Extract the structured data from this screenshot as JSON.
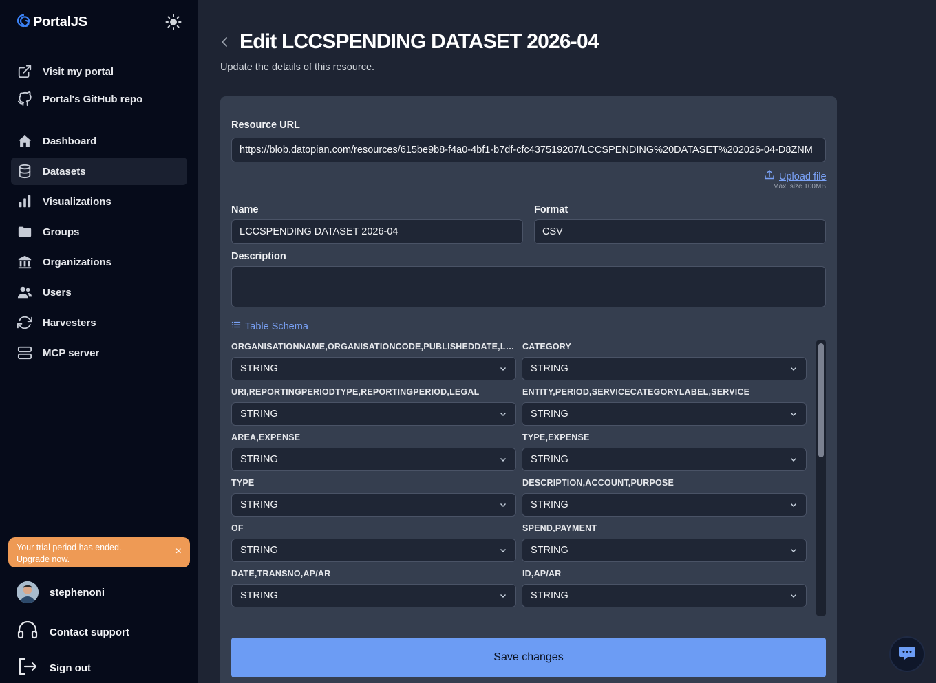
{
  "sidebar": {
    "brand": "PortalJS",
    "top_links": [
      {
        "label": "Visit my portal",
        "icon": "external-link-icon"
      },
      {
        "label": "Portal's GitHub repo",
        "icon": "github-icon"
      }
    ],
    "nav": [
      {
        "label": "Dashboard",
        "icon": "home-icon",
        "active": false
      },
      {
        "label": "Datasets",
        "icon": "database-icon",
        "active": true
      },
      {
        "label": "Visualizations",
        "icon": "bar-chart-icon",
        "active": false
      },
      {
        "label": "Groups",
        "icon": "folder-icon",
        "active": false
      },
      {
        "label": "Organizations",
        "icon": "building-icon",
        "active": false
      },
      {
        "label": "Users",
        "icon": "users-icon",
        "active": false
      },
      {
        "label": "Harvesters",
        "icon": "refresh-icon",
        "active": false
      },
      {
        "label": "MCP server",
        "icon": "server-icon",
        "active": false
      }
    ],
    "trial": {
      "text": "Your trial period has ended.",
      "link": "Upgrade now.",
      "close": "×"
    },
    "user": {
      "name": "stephenoni"
    },
    "contact": "Contact support",
    "signout": "Sign out"
  },
  "page": {
    "title": "Edit LCCSPENDING DATASET 2026-04",
    "subtitle": "Update the details of this resource."
  },
  "form": {
    "resource_url_label": "Resource URL",
    "resource_url_value": "https://blob.datopian.com/resources/615be9b8-f4a0-4bf1-b7df-cfc437519207/LCCSPENDING%20DATASET%202026-04-D8ZNM",
    "upload_label": "Upload file",
    "max_size": "Max. size 100MB",
    "name_label": "Name",
    "name_value": "LCCSPENDING DATASET 2026-04",
    "format_label": "Format",
    "format_value": "CSV",
    "description_label": "Description",
    "description_value": "",
    "schema_toggle": "Table Schema",
    "schema_fields": [
      {
        "name": "ORGANISATIONNAME,ORGANISATIONCODE,PUBLISHEDDATE,LA...",
        "type": "STRING"
      },
      {
        "name": "CATEGORY",
        "type": "STRING"
      },
      {
        "name": "URI,REPORTINGPERIODTYPE,REPORTINGPERIOD,LEGAL",
        "type": "STRING"
      },
      {
        "name": "ENTITY,PERIOD,SERVICECATEGORYLABEL,SERVICE",
        "type": "STRING"
      },
      {
        "name": "AREA,EXPENSE",
        "type": "STRING"
      },
      {
        "name": "TYPE,EXPENSE",
        "type": "STRING"
      },
      {
        "name": "TYPE",
        "type": "STRING"
      },
      {
        "name": "DESCRIPTION,ACCOUNT,PURPOSE",
        "type": "STRING"
      },
      {
        "name": "OF",
        "type": "STRING"
      },
      {
        "name": "SPEND,PAYMENT",
        "type": "STRING"
      },
      {
        "name": "DATE,TRANSNO,AP/AR",
        "type": "STRING"
      },
      {
        "name": "ID,AP/AR",
        "type": "STRING"
      }
    ],
    "save_label": "Save changes"
  },
  "colors": {
    "sidebar_bg": "#060b1a",
    "main_bg": "#1e2433",
    "card_bg": "#353e4f",
    "accent": "#6c9cf4",
    "link": "#7aa2f7",
    "trial_bg": "#ee9a55"
  }
}
